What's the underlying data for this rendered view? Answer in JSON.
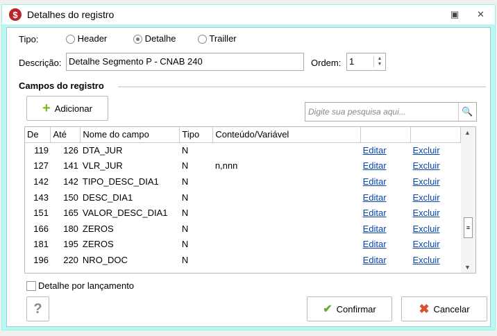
{
  "window": {
    "title": "Detalhes do registro"
  },
  "tipo": {
    "label": "Tipo:",
    "options": [
      "Header",
      "Detalhe",
      "Trailler"
    ],
    "selected": "Detalhe"
  },
  "descricao": {
    "label": "Descrição:",
    "value": "Detalhe Segmento P - CNAB 240"
  },
  "ordem": {
    "label": "Ordem:",
    "value": "1"
  },
  "section": "Campos do registro",
  "add_label": "Adicionar",
  "search": {
    "placeholder": "Digite sua pesquisa aqui..."
  },
  "table": {
    "headers": [
      "De",
      "Até",
      "Nome do campo",
      "Tipo",
      "Conteúdo/Variável",
      "",
      ""
    ],
    "rows": [
      {
        "de": "119",
        "ate": "126",
        "nome": "DTA_JUR",
        "tipo": "N",
        "conteudo": "",
        "edit": "Editar",
        "del": "Excluir"
      },
      {
        "de": "127",
        "ate": "141",
        "nome": "VLR_JUR",
        "tipo": "N",
        "conteudo": "n,nnn",
        "edit": "Editar",
        "del": "Excluir"
      },
      {
        "de": "142",
        "ate": "142",
        "nome": "TIPO_DESC_DIA1",
        "tipo": "N",
        "conteudo": "",
        "edit": "Editar",
        "del": "Excluir"
      },
      {
        "de": "143",
        "ate": "150",
        "nome": "DESC_DIA1",
        "tipo": "N",
        "conteudo": "",
        "edit": "Editar",
        "del": "Excluir"
      },
      {
        "de": "151",
        "ate": "165",
        "nome": "VALOR_DESC_DIA1",
        "tipo": "N",
        "conteudo": "",
        "edit": "Editar",
        "del": "Excluir"
      },
      {
        "de": "166",
        "ate": "180",
        "nome": "ZEROS",
        "tipo": "N",
        "conteudo": "",
        "edit": "Editar",
        "del": "Excluir"
      },
      {
        "de": "181",
        "ate": "195",
        "nome": "ZEROS",
        "tipo": "N",
        "conteudo": "",
        "edit": "Editar",
        "del": "Excluir"
      },
      {
        "de": "196",
        "ate": "220",
        "nome": "NRO_DOC",
        "tipo": "N",
        "conteudo": "",
        "edit": "Editar",
        "del": "Excluir"
      }
    ]
  },
  "checkbox_label": "Detalhe por lançamento",
  "help_label": "?",
  "confirm_label": "Confirmar",
  "cancel_label": "Cancelar"
}
